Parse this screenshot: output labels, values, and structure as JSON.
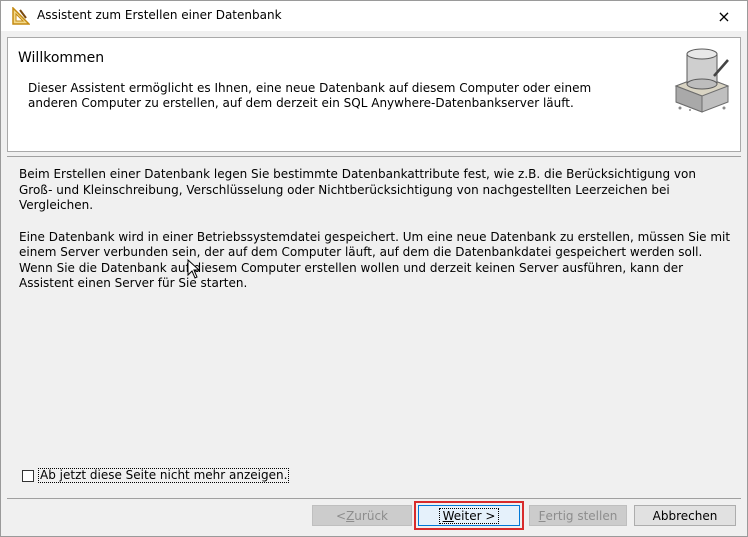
{
  "window": {
    "title": "Assistent zum Erstellen einer Datenbank",
    "close_label": "×"
  },
  "header": {
    "title": "Willkommen",
    "description": "Dieser Assistent ermöglicht es Ihnen, eine neue Datenbank auf diesem Computer oder einem anderen Computer zu erstellen, auf dem derzeit ein SQL Anywhere-Datenbankserver läuft."
  },
  "content": {
    "paragraphs": [
      "Beim Erstellen einer Datenbank legen Sie bestimmte Datenbankattribute fest, wie z.B. die Berücksichtigung von Groß- und Kleinschreibung, Verschlüsselung oder Nichtberücksichtigung von nachgestellten Leerzeichen bei Vergleichen.",
      "Eine Datenbank wird in einer Betriebssystemdatei gespeichert. Um eine neue Datenbank zu erstellen, müssen Sie mit einem Server verbunden sein, der auf dem Computer läuft, auf dem die Datenbankdatei gespeichert werden soll. Wenn Sie die Datenbank auf diesem Computer erstellen wollen und derzeit keinen Server ausführen, kann der Assistent einen Server für Sie starten."
    ]
  },
  "options": {
    "dont_show_label": "Ab jetzt diese Seite nicht mehr anzeigen.",
    "dont_show_checked": false
  },
  "buttons": {
    "back": {
      "mnemonic": "Z",
      "rest": "urück",
      "prefix": "< "
    },
    "next": {
      "mnemonic": "W",
      "rest": "eiter >"
    },
    "finish": {
      "mnemonic": "F",
      "rest": "ertig stellen"
    },
    "cancel": "Abbrechen"
  },
  "colors": {
    "highlight": "#d82b2b",
    "default_button_border": "#0078d7"
  },
  "icons": {
    "app": "wizard-triangle-icon",
    "header": "database-cylinder-icon",
    "close": "close-icon",
    "pointer": "mouse-pointer-icon"
  }
}
